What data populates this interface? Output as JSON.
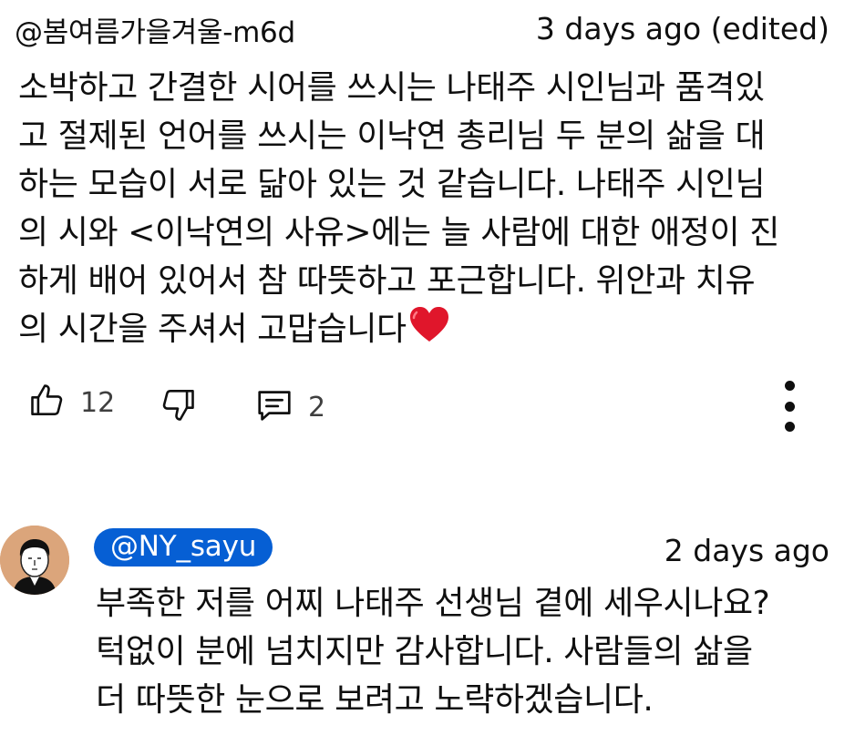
{
  "comment": {
    "handle": "@봄여름가을겨울-m6d",
    "time": "3 days ago (edited)",
    "text": "소박하고 간결한 시어를 쓰시는 나태주 시인님과 품격있\n고 절제된 언어를 쓰시는 이낙연 총리님 두 분의 삶을 대\n하는 모습이 서로 닮아 있는 것 같습니다.  나태주 시인님\n의 시와 <이낙연의 사유>에는 늘 사람에 대한 애정이 진\n하게 배어 있어서 참 따뜻하고 포근합니다. 위안과 치유\n의 시간을 주셔서 고맙습니다",
    "like_count": "12",
    "reply_count": "2",
    "icons": {
      "like": "thumbs-up-icon",
      "dislike": "thumbs-down-icon",
      "reply": "comment-icon",
      "more": "more-vertical-icon",
      "heart": "red-heart-emoji"
    }
  },
  "reply": {
    "handle": "@NY_sayu",
    "time": "2 days ago",
    "text": "부족한 저를 어찌 나태주 선생님 곁에 세우시나요?\n턱없이 분에 넘치지만 감사합니다. 사람들의 삶을\n더 따뜻한 눈으로 보려고 노략하겠습니다.",
    "avatar_color": "#dba57b",
    "pill_color": "#065fd4"
  }
}
